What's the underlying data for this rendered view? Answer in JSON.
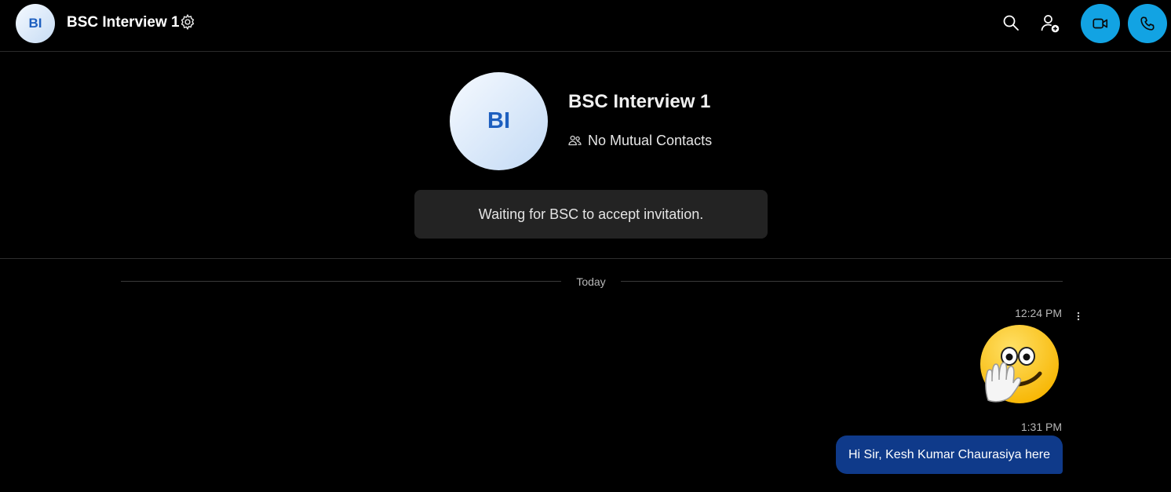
{
  "header": {
    "avatar_initials": "BI",
    "title": "BSC Interview 1",
    "settings_icon": "gear-icon",
    "search_icon": "search-icon",
    "add_person_icon": "add-person-icon",
    "video_icon": "video-camera-icon",
    "call_icon": "phone-icon"
  },
  "profile": {
    "avatar_initials": "BI",
    "name": "BSC Interview 1",
    "mutual_contacts": "No Mutual Contacts",
    "mutual_icon": "contacts-icon"
  },
  "invitation": {
    "text": "Waiting for BSC to accept invitation."
  },
  "chat": {
    "date_label": "Today",
    "messages": [
      {
        "time": "12:24 PM",
        "type": "emoji",
        "emoji": "waving-hand-face-emoji"
      },
      {
        "time": "1:31 PM",
        "type": "text",
        "text": "Hi Sir, Kesh Kumar Chaurasiya here"
      }
    ]
  },
  "colors": {
    "background": "#000000",
    "accent": "#12a3e3",
    "own_bubble": "#0f3a8a",
    "avatar_text": "#1d5fbf",
    "panel": "#232323"
  }
}
